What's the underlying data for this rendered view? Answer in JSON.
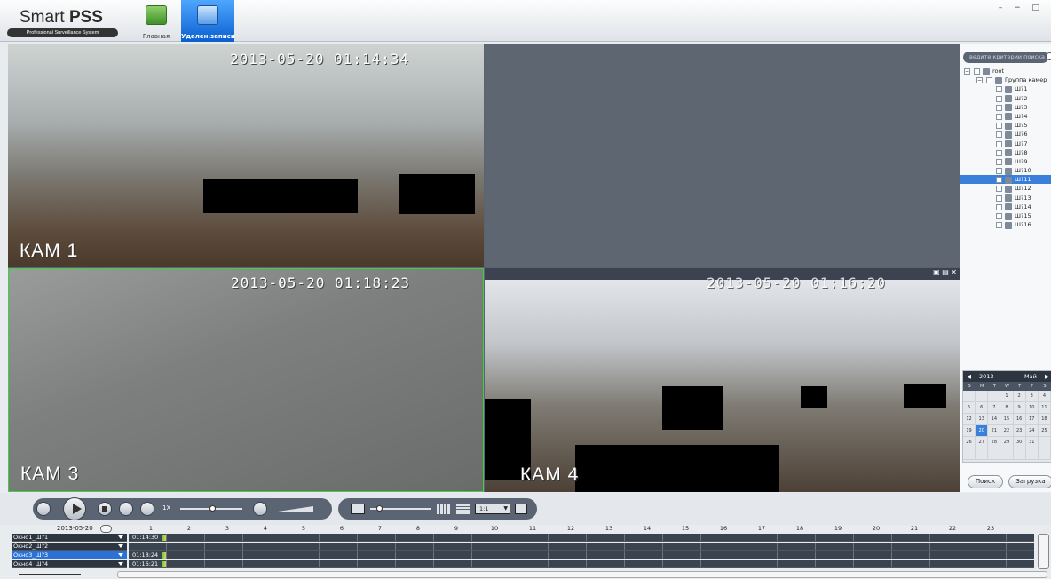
{
  "header": {
    "app_name_prefix": "Smart ",
    "app_name_bold": "PSS",
    "subtitle": "Professional Surveillance System",
    "nav": [
      {
        "label": "Главная",
        "icon": "home-icon"
      },
      {
        "label": "Удален.записи",
        "icon": "remote-playback-icon"
      }
    ],
    "window_controls": "– − □"
  },
  "video": {
    "panes": [
      {
        "timestamp": "2013-05-20 01:14:34",
        "camera": "КАМ 1"
      },
      {
        "timestamp": "",
        "camera": ""
      },
      {
        "timestamp": "2013-05-20 01:18:23",
        "camera": "КАМ 3"
      },
      {
        "timestamp": "2013-05-20 01:16:20",
        "camera": "КАМ 4"
      }
    ],
    "pane4_tools": "▣ ▤ ✕"
  },
  "sidebar": {
    "search_placeholder": "ведите критерии поиска",
    "tree": {
      "root": "root",
      "group": "Группа камер",
      "cameras": [
        "Ш?1",
        "Ш?2",
        "Ш?3",
        "Ш?4",
        "Ш?5",
        "Ш?6",
        "Ш?7",
        "Ш?8",
        "Ш?9",
        "Ш?10",
        "Ш?11",
        "Ш?12",
        "Ш?13",
        "Ш?14",
        "Ш?15",
        "Ш?16"
      ],
      "selected_index": 10
    },
    "calendar": {
      "year": "2013",
      "month": "Май",
      "weekdays": [
        "S",
        "M",
        "T",
        "W",
        "T",
        "F",
        "S"
      ],
      "weeks": [
        [
          "",
          "",
          "",
          "1",
          "2",
          "3",
          "4"
        ],
        [
          "5",
          "6",
          "7",
          "8",
          "9",
          "10",
          "11"
        ],
        [
          "12",
          "13",
          "14",
          "15",
          "16",
          "17",
          "18"
        ],
        [
          "19",
          "20",
          "21",
          "22",
          "23",
          "24",
          "25"
        ],
        [
          "26",
          "27",
          "28",
          "29",
          "30",
          "31",
          ""
        ],
        [
          "",
          "",
          "",
          "",
          "",
          "",
          ""
        ]
      ],
      "today": "20"
    },
    "buttons": {
      "search": "Поиск",
      "download": "Загрузка"
    }
  },
  "controls": {
    "speed_label": "1X",
    "speed_level": 0.5,
    "ratio_value": "1:1"
  },
  "timeline": {
    "date": "2013-05-20",
    "hours": [
      "1",
      "2",
      "3",
      "4",
      "5",
      "6",
      "7",
      "8",
      "9",
      "10",
      "11",
      "12",
      "13",
      "14",
      "15",
      "16",
      "17",
      "18",
      "19",
      "20",
      "21",
      "22",
      "23"
    ],
    "rows": [
      {
        "name": "Окно1_Ш?1",
        "time": "01:14:30",
        "selected": false
      },
      {
        "name": "Окно2_Ш?2",
        "time": "",
        "selected": false
      },
      {
        "name": "Окно3_Ш?3",
        "time": "01:18:24",
        "selected": true
      },
      {
        "name": "Окно4_Ш?4",
        "time": "01:16:21",
        "selected": false
      }
    ]
  },
  "colors": {
    "accent": "#2a72d8",
    "panel_dark": "#2d3540",
    "video_bg": "#5a6370",
    "recording_mark": "#64d04a",
    "selection_border": "#3fcf3f"
  }
}
